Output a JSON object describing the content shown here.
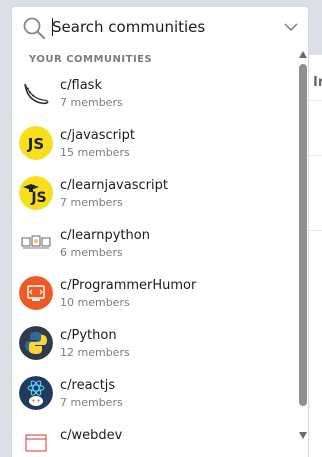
{
  "search": {
    "placeholder": "Search communities",
    "value": ""
  },
  "dropdown": {
    "section_label": "YOUR COMMUNITIES",
    "communities": [
      {
        "name": "c/flask",
        "members": "7 members",
        "icon": "flask-horn-icon"
      },
      {
        "name": "c/javascript",
        "members": "15 members",
        "icon": "js-logo-icon"
      },
      {
        "name": "c/learnjavascript",
        "members": "7 members",
        "icon": "js-graduation-icon"
      },
      {
        "name": "c/learnpython",
        "members": "6 members",
        "icon": "python-sketch-icon"
      },
      {
        "name": "c/ProgrammerHumor",
        "members": "10 members",
        "icon": "programmer-humor-icon"
      },
      {
        "name": "c/Python",
        "members": "12 members",
        "icon": "python-logo-icon"
      },
      {
        "name": "c/reactjs",
        "members": "7 members",
        "icon": "react-snoo-icon"
      },
      {
        "name": "c/webdev",
        "members": "",
        "icon": "webdev-icon"
      }
    ]
  },
  "background": {
    "fragment": "In"
  },
  "colors": {
    "js_yellow": "#f7df1e",
    "humor_orange": "#ee5a24",
    "python_blue": "#306998",
    "python_yellow": "#ffd43b",
    "react_navy": "#1f3a5f"
  }
}
